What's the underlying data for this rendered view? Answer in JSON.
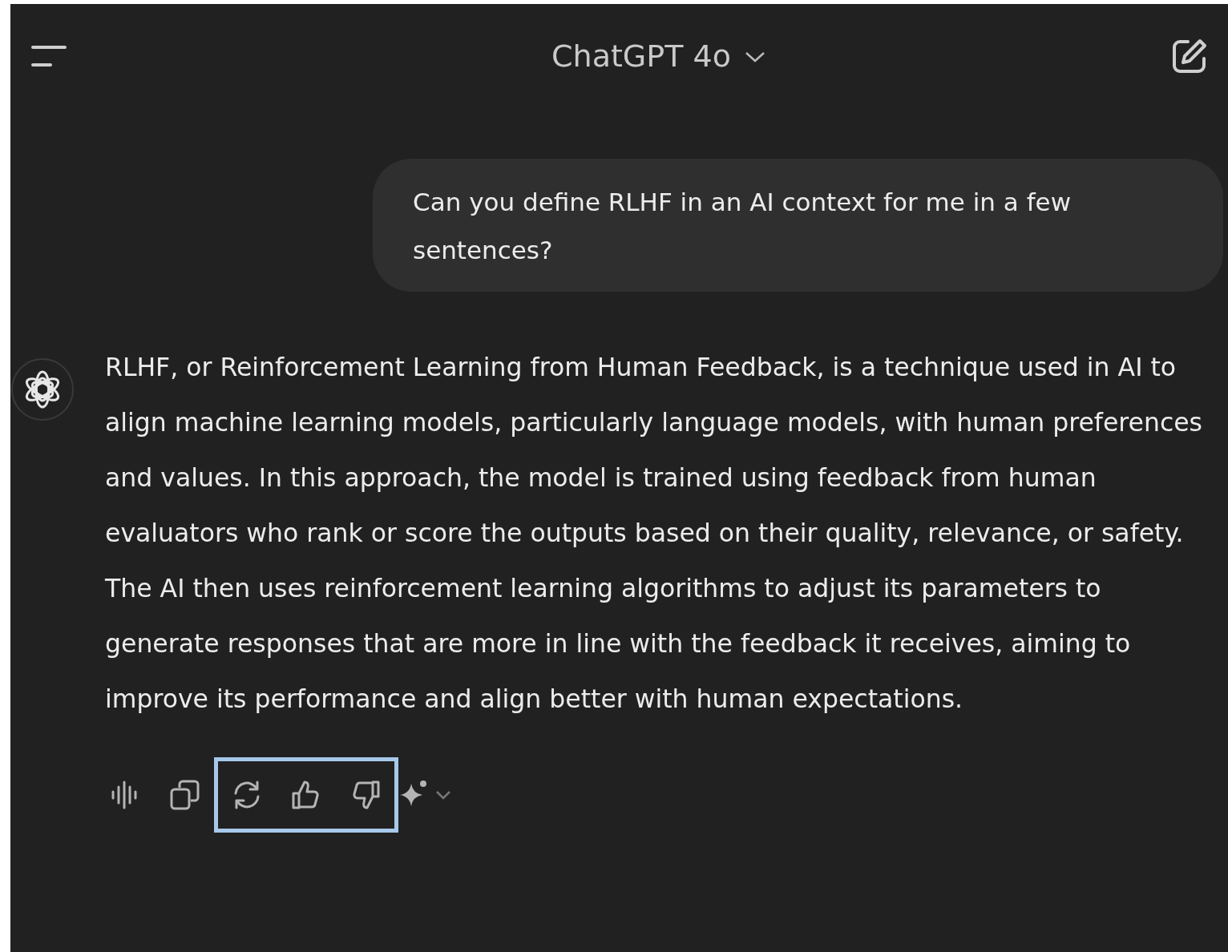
{
  "header": {
    "model_title": "ChatGPT 4o"
  },
  "user_message": {
    "text": "Can you define RLHF in an AI context for me in a few sentences?"
  },
  "assistant_message": {
    "text": "RLHF, or Reinforcement Learning from Human Feedback, is a technique used in AI to align machine learning models, particularly language models, with human preferences and values. In this approach, the model is trained using feedback from human evaluators who rank or score the outputs based on their quality, relevance, or safety. The AI then uses reinforcement learning algorithms to adjust its parameters to generate responses that are more in line with the feedback it receives, aiming to improve its performance and align better with human expectations."
  },
  "actions": [
    {
      "kind": "read_aloud"
    },
    {
      "kind": "copy"
    }
  ],
  "highlighted_actions": [
    {
      "kind": "regenerate"
    },
    {
      "kind": "thumbs_up"
    },
    {
      "kind": "thumbs_down"
    }
  ],
  "trailing_actions": [
    {
      "kind": "sparkle_menu"
    }
  ]
}
